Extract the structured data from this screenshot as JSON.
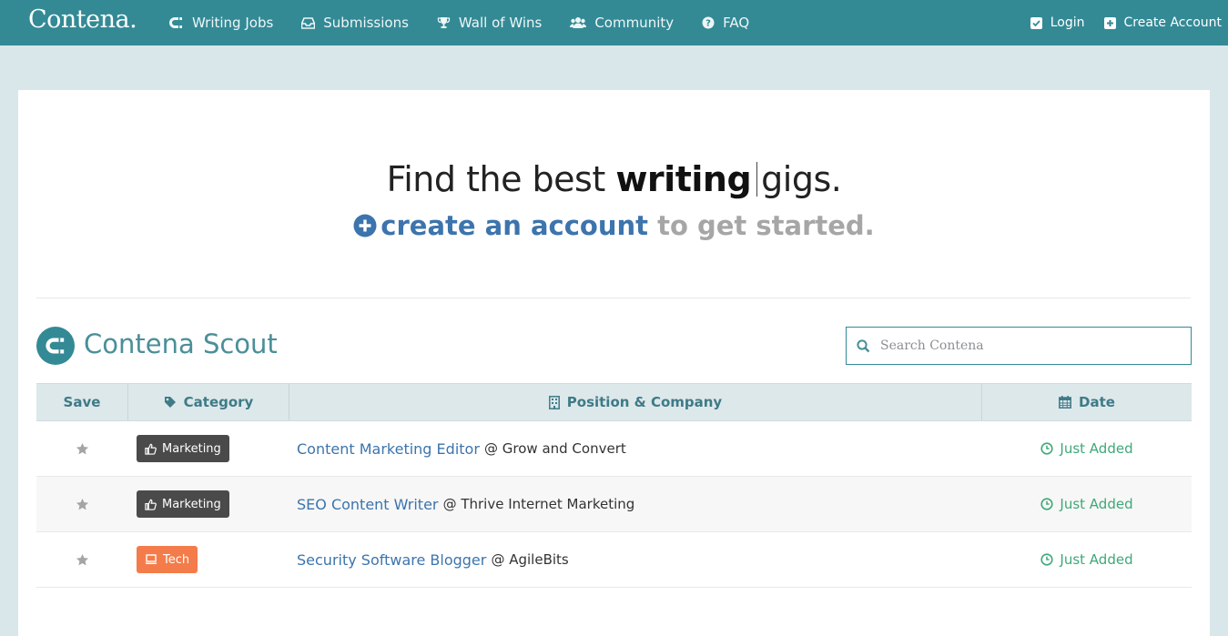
{
  "brand": "Contena.",
  "nav": {
    "left": [
      {
        "label": "Writing Jobs",
        "icon": "magnet-icon"
      },
      {
        "label": "Submissions",
        "icon": "inbox-icon"
      },
      {
        "label": "Wall of Wins",
        "icon": "trophy-icon"
      },
      {
        "label": "Community",
        "icon": "users-icon"
      },
      {
        "label": "FAQ",
        "icon": "question-circle-icon"
      }
    ],
    "right": [
      {
        "label": "Login",
        "icon": "check-square-icon"
      },
      {
        "label": "Create Account",
        "icon": "plus-square-icon"
      }
    ]
  },
  "hero": {
    "title_prefix": "Find the best",
    "title_bold": "writing",
    "title_suffix": "gigs.",
    "sub_link": "create an account",
    "sub_rest": "to get started."
  },
  "scout": {
    "title": "Contena Scout",
    "search_placeholder": "Search Contena"
  },
  "table": {
    "headers": {
      "save": "Save",
      "category": "Category",
      "position": "Position & Company",
      "date": "Date"
    },
    "rows": [
      {
        "category": "Marketing",
        "category_color": "#4a4a4a",
        "position": "Content Marketing Editor",
        "company": "@ Grow and Convert",
        "date": "Just Added"
      },
      {
        "category": "Marketing",
        "category_color": "#4a4a4a",
        "position": "SEO Content Writer",
        "company": "@ Thrive Internet Marketing",
        "date": "Just Added"
      },
      {
        "category": "Tech",
        "category_color": "#f47c4a",
        "position": "Security Software Blogger",
        "company": "@ AgileBits",
        "date": "Just Added"
      }
    ]
  },
  "colors": {
    "topbar": "#338a95",
    "link": "#3c74ad",
    "date_green": "#3ea878"
  }
}
